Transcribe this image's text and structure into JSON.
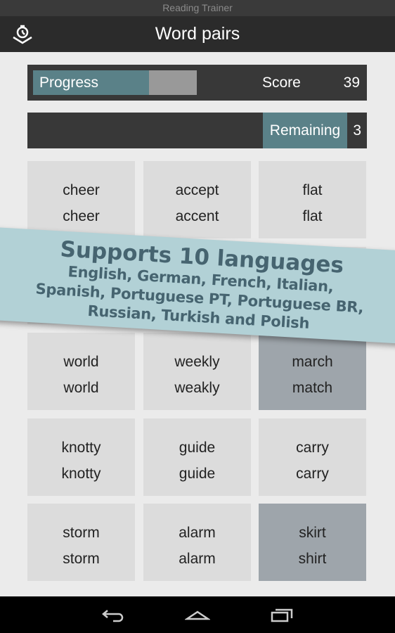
{
  "window": {
    "title": "Reading Trainer"
  },
  "header": {
    "title": "Word pairs",
    "icon": "stopwatch-book-icon"
  },
  "stats": {
    "progress_label": "Progress",
    "progress_percent": 71,
    "score_label": "Score",
    "score": "39",
    "remaining_label": "Remaining",
    "remaining": "3"
  },
  "colors": {
    "accent": "#5a8188",
    "wrong_cell": "#9ea5ab",
    "cell": "#dcdcdc",
    "banner": "#b2d1d6"
  },
  "grid": {
    "rows": [
      [
        {
          "top": "cheer",
          "bottom": "cheer",
          "state": "normal"
        },
        {
          "top": "accept",
          "bottom": "accent",
          "state": "normal"
        },
        {
          "top": "flat",
          "bottom": "flat",
          "state": "normal"
        }
      ],
      [
        {
          "top": "",
          "bottom": "",
          "state": "normal"
        },
        {
          "top": "",
          "bottom": "",
          "state": "normal"
        },
        {
          "top": "",
          "bottom": "",
          "state": "normal"
        }
      ],
      [
        {
          "top": "world",
          "bottom": "world",
          "state": "normal"
        },
        {
          "top": "weekly",
          "bottom": "weakly",
          "state": "normal"
        },
        {
          "top": "march",
          "bottom": "match",
          "state": "marked"
        }
      ],
      [
        {
          "top": "knotty",
          "bottom": "knotty",
          "state": "normal"
        },
        {
          "top": "guide",
          "bottom": "guide",
          "state": "normal"
        },
        {
          "top": "carry",
          "bottom": "carry",
          "state": "normal"
        }
      ],
      [
        {
          "top": "storm",
          "bottom": "storm",
          "state": "normal"
        },
        {
          "top": "alarm",
          "bottom": "alarm",
          "state": "normal"
        },
        {
          "top": "skirt",
          "bottom": "shirt",
          "state": "marked"
        }
      ]
    ]
  },
  "banner": {
    "heading": "Supports 10 languages",
    "lines": [
      "English, German, French, Italian,",
      "Spanish, Portuguese PT, Portuguese BR,",
      "Russian, Turkish and Polish"
    ]
  },
  "navbar": {
    "icons": [
      "back-icon",
      "home-icon",
      "recent-apps-icon"
    ]
  }
}
